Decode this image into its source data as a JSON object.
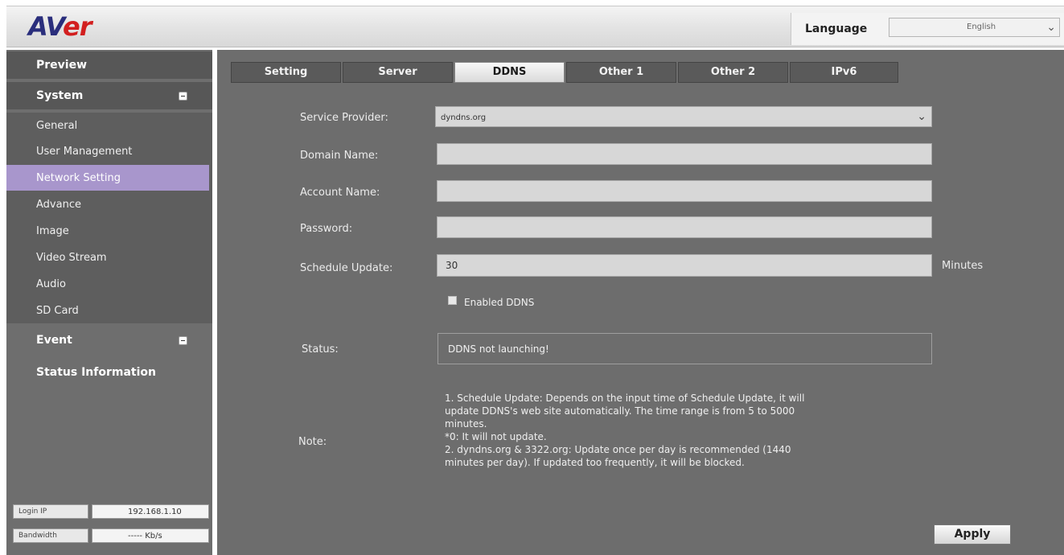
{
  "header": {
    "logo_text_1": "AV",
    "logo_text_2": "er",
    "language_label": "Language",
    "language_value": "English"
  },
  "sidebar": {
    "preview": "Preview",
    "system": "System",
    "items": [
      {
        "label": "General"
      },
      {
        "label": "User Management"
      },
      {
        "label": "Network Setting"
      },
      {
        "label": "Advance"
      },
      {
        "label": "Image"
      },
      {
        "label": "Video Stream"
      },
      {
        "label": "Audio"
      },
      {
        "label": "SD Card"
      }
    ],
    "event": "Event",
    "status_information": "Status Information",
    "login_ip_label": "Login IP",
    "login_ip_value": "192.168.1.10",
    "bandwidth_label": "Bandwidth",
    "bandwidth_value": "----- Kb/s"
  },
  "tabs": [
    {
      "label": "Setting"
    },
    {
      "label": "Server"
    },
    {
      "label": "DDNS"
    },
    {
      "label": "Other 1"
    },
    {
      "label": "Other 2"
    },
    {
      "label": "IPv6"
    }
  ],
  "form": {
    "service_provider_label": "Service Provider:",
    "service_provider_value": "dyndns.org",
    "domain_name_label": "Domain Name:",
    "domain_name_value": "",
    "account_name_label": "Account Name:",
    "account_name_value": "",
    "password_label": "Password:",
    "password_value": "",
    "schedule_update_label": "Schedule Update:",
    "schedule_update_value": "30",
    "schedule_update_unit": "Minutes",
    "enabled_ddns_label": "Enabled DDNS",
    "status_label": "Status:",
    "status_value": "DDNS not launching!",
    "note_label": "Note:",
    "note_lines": [
      "1. Schedule Update: Depends on the input time of Schedule Update, it will",
      "update DDNS's web site automatically. The time range is from 5 to 5000",
      "minutes.",
      "*0: It will not update.",
      "2. dyndns.org & 3322.org: Update once per day is recommended (1440",
      "minutes per day). If updated too frequently, it will be blocked."
    ],
    "apply_label": "Apply"
  },
  "colors": {
    "sidebar_active": "#a896cc",
    "panel_bg": "#6d6d6d",
    "logo_blue": "#2a2e7c",
    "logo_red": "#d21f1f"
  }
}
